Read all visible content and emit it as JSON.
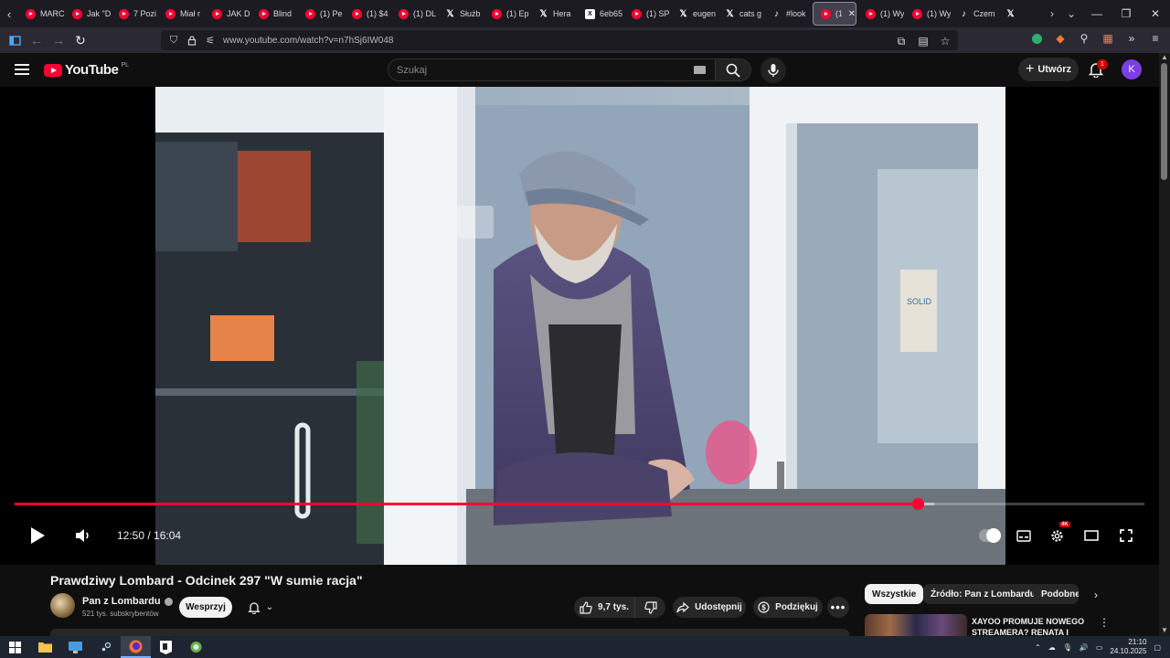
{
  "browser": {
    "tabs": [
      {
        "label": "MARC",
        "icon": "youtube-icon",
        "active": false
      },
      {
        "label": "Jak \"D",
        "icon": "youtube-icon",
        "active": false
      },
      {
        "label": "7 Pozi",
        "icon": "youtube-icon",
        "active": false
      },
      {
        "label": "Miał r",
        "icon": "youtube-icon",
        "active": false
      },
      {
        "label": "JAK D",
        "icon": "youtube-icon",
        "active": false
      },
      {
        "label": "Blind",
        "icon": "youtube-icon",
        "active": false
      },
      {
        "label": "(1) Pe",
        "icon": "youtube-icon",
        "active": false
      },
      {
        "label": "(1) $4",
        "icon": "youtube-icon",
        "active": false
      },
      {
        "label": "(1) DL",
        "icon": "youtube-icon",
        "active": false
      },
      {
        "label": "Służb",
        "icon": "x-icon",
        "active": false
      },
      {
        "label": "(1) Ep",
        "icon": "youtube-icon",
        "active": false
      },
      {
        "label": "Hera",
        "icon": "x-icon",
        "active": false
      },
      {
        "label": "6eb65",
        "icon": "github-icon",
        "active": false
      },
      {
        "label": "(1) SP",
        "icon": "youtube-icon",
        "active": false
      },
      {
        "label": "eugen",
        "icon": "x-icon",
        "active": false
      },
      {
        "label": "cats g",
        "icon": "x-icon",
        "active": false
      },
      {
        "label": "#look",
        "icon": "tiktok-icon",
        "active": false
      },
      {
        "label": "(1)",
        "icon": "youtube-icon",
        "active": true
      },
      {
        "label": "(1) Wy",
        "icon": "youtube-icon",
        "active": false
      },
      {
        "label": "(1) Wy",
        "icon": "youtube-icon",
        "active": false
      },
      {
        "label": "Czem",
        "icon": "tiktok-icon",
        "active": false
      },
      {
        "label": "",
        "icon": "x-icon",
        "active": false
      }
    ],
    "url": "www.youtube.com/watch?v=n7hSj6IW048"
  },
  "youtube": {
    "logo_text": "YouTube",
    "country_code": "PL",
    "search_placeholder": "Szukaj",
    "create_label": "Utwórz",
    "notification_count": "1",
    "avatar_letter": "K"
  },
  "player": {
    "time_current": "12:50",
    "time_total": "16:04",
    "time_display": "12:50 / 16:04",
    "played_fraction": 0.799,
    "buffered_fraction": 0.814,
    "quality_badge": "4K"
  },
  "video": {
    "title": "Prawdziwy Lombard - Odcinek 297 \"W sumie racja\"",
    "channel_name": "Pan z Lombardu",
    "subscribers": "521 tys. subskrybentów",
    "support_label": "Wesprzyj",
    "likes": "9,7 tys.",
    "share_label": "Udostępnij",
    "thanks_label": "Podziękuj",
    "sign_text": "SOLID"
  },
  "recommendations": {
    "chips": [
      "Wszystkie",
      "Źródło: Pan z Lombardu",
      "Podobne"
    ],
    "first_title": "XAYOO PROMUJE NOWEGO STREAMERA? RENATA I"
  },
  "taskbar": {
    "time": "21:10",
    "date": "24.10.2025"
  },
  "colors": {
    "accent": "#ff0033",
    "background": "#0f0f0f",
    "chip_bg": "#272727"
  }
}
